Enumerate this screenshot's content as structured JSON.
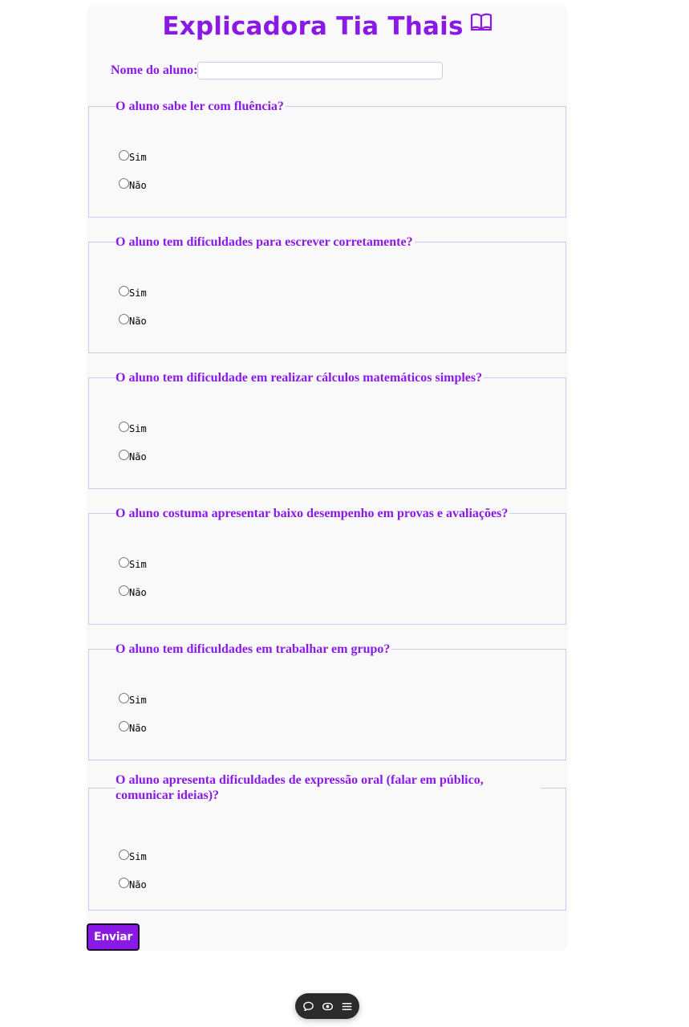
{
  "header": {
    "title": "Explicadora Tia Thais",
    "icon": "open-book-icon"
  },
  "student": {
    "label": "Nome do aluno:",
    "value": "",
    "placeholder": ""
  },
  "questions": [
    {
      "legend": "O aluno sabe ler com fluência?",
      "options": [
        "Sim",
        "Não"
      ]
    },
    {
      "legend": "O aluno tem dificuldades para escrever corretamente?",
      "options": [
        "Sim",
        "Não"
      ]
    },
    {
      "legend": "O aluno tem dificuldade em realizar cálculos matemáticos simples?",
      "options": [
        "Sim",
        "Não"
      ]
    },
    {
      "legend": "O aluno costuma apresentar baixo desempenho em provas e avaliações?",
      "options": [
        "Sim",
        "Não"
      ]
    },
    {
      "legend": "O aluno tem dificuldades em trabalhar em grupo?",
      "options": [
        "Sim",
        "Não"
      ]
    },
    {
      "legend": "O aluno apresenta dificuldades de expressão oral (falar em público, comunicar ideias)?",
      "options": [
        "Sim",
        "Não"
      ]
    }
  ],
  "submit": {
    "label": "Enviar"
  },
  "toolbar": {
    "icons": [
      "comment-icon",
      "eye-icon",
      "menu-icon"
    ]
  },
  "colors": {
    "accent": "#8a19e6",
    "border": "#d5c6f1",
    "card": "#f9f9fa"
  }
}
